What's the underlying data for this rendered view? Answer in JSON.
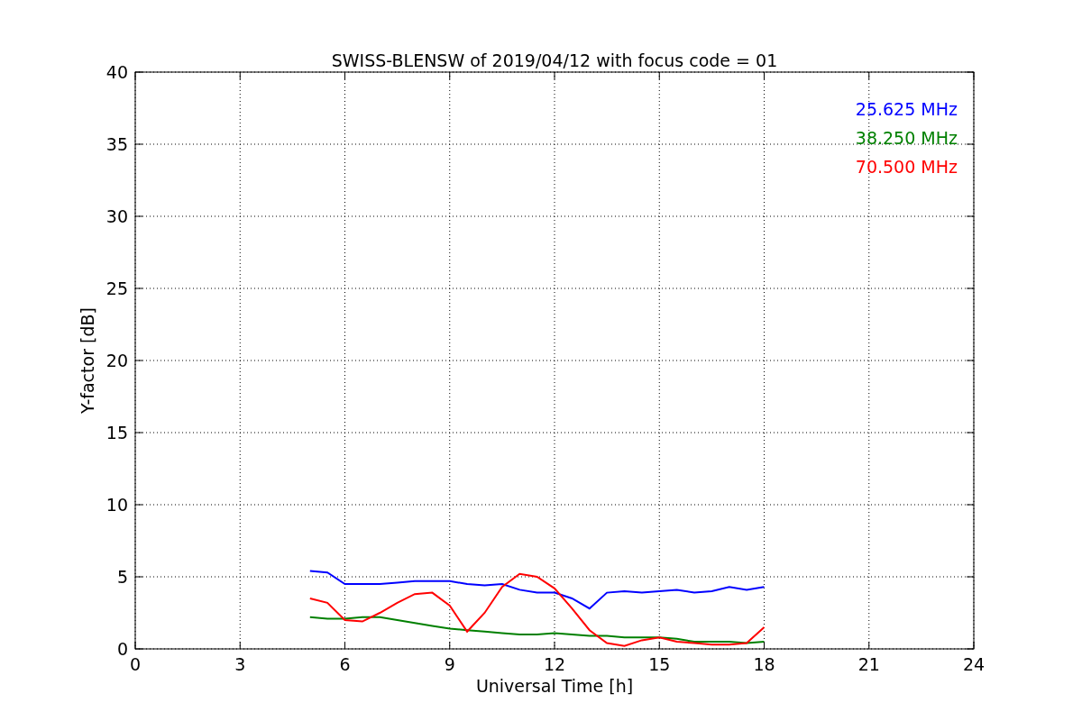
{
  "figure": {
    "chart_data": {
      "type": "line",
      "title": "SWISS-BLENSW of 2019/04/12 with focus code = 01",
      "xlabel": "Universal Time [h]",
      "ylabel": "Y-factor [dB]",
      "x": [
        5,
        5.5,
        6,
        6.5,
        7,
        7.5,
        8,
        8.5,
        9,
        9.5,
        10,
        10.5,
        11,
        11.5,
        12,
        12.5,
        13,
        13.5,
        14,
        14.5,
        15,
        15.5,
        16,
        16.5,
        17,
        17.5,
        18
      ],
      "series": [
        {
          "name": "25.625 MHz",
          "color": "#0000ff",
          "values": [
            5.4,
            5.3,
            4.5,
            4.5,
            4.5,
            4.6,
            4.7,
            4.7,
            4.7,
            4.5,
            4.4,
            4.5,
            4.1,
            3.9,
            3.9,
            3.5,
            2.8,
            3.9,
            4.0,
            3.9,
            4.0,
            4.1,
            3.9,
            4.0,
            4.3,
            4.1,
            4.3
          ]
        },
        {
          "name": "38.250 MHz",
          "color": "#008000",
          "values": [
            2.2,
            2.1,
            2.1,
            2.2,
            2.2,
            2.0,
            1.8,
            1.6,
            1.4,
            1.3,
            1.2,
            1.1,
            1.0,
            1.0,
            1.1,
            1.0,
            0.9,
            0.9,
            0.8,
            0.8,
            0.8,
            0.7,
            0.5,
            0.5,
            0.5,
            0.4,
            0.5
          ]
        },
        {
          "name": "70.500 MHz",
          "color": "#ff0000",
          "values": [
            3.5,
            3.2,
            2.0,
            1.9,
            2.5,
            3.2,
            3.8,
            3.9,
            3.0,
            1.2,
            2.5,
            4.3,
            5.2,
            5.0,
            4.2,
            2.8,
            1.3,
            0.4,
            0.2,
            0.6,
            0.8,
            0.5,
            0.4,
            0.3,
            0.3,
            0.4,
            1.5
          ]
        }
      ],
      "grid": true,
      "xlim": [
        0,
        24
      ],
      "ylim": [
        0,
        40
      ],
      "xticks": [
        0,
        3,
        6,
        9,
        12,
        15,
        18,
        21,
        24
      ],
      "yticks": [
        0,
        5,
        10,
        15,
        20,
        25,
        30,
        35,
        40
      ]
    }
  }
}
